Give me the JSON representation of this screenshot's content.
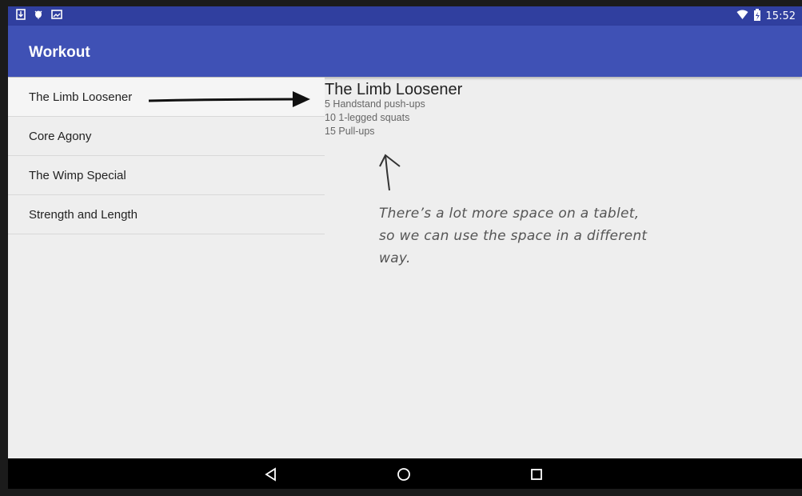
{
  "status_bar": {
    "time": "15:52",
    "left_icons": [
      "download-icon",
      "bug-icon",
      "photo-icon"
    ],
    "right_icons": [
      "wifi-icon",
      "battery-icon"
    ]
  },
  "app_bar": {
    "title": "Workout"
  },
  "workouts": {
    "items": [
      {
        "label": "The Limb Loosener",
        "selected": true
      },
      {
        "label": "Core Agony"
      },
      {
        "label": "The Wimp Special"
      },
      {
        "label": "Strength and Length"
      }
    ]
  },
  "detail": {
    "title": "The Limb Loosener",
    "description": "5 Handstand push-ups\n10 1-legged squats\n15 Pull-ups"
  },
  "annotation": {
    "text": "There’s a lot more space on a tablet, so we can use the space in a different way."
  },
  "nav_bar": {
    "buttons": [
      "back-icon",
      "home-icon",
      "recents-icon"
    ]
  },
  "colors": {
    "status_bar": "#303f9f",
    "app_bar": "#3f51b5",
    "background": "#eeeeee"
  }
}
